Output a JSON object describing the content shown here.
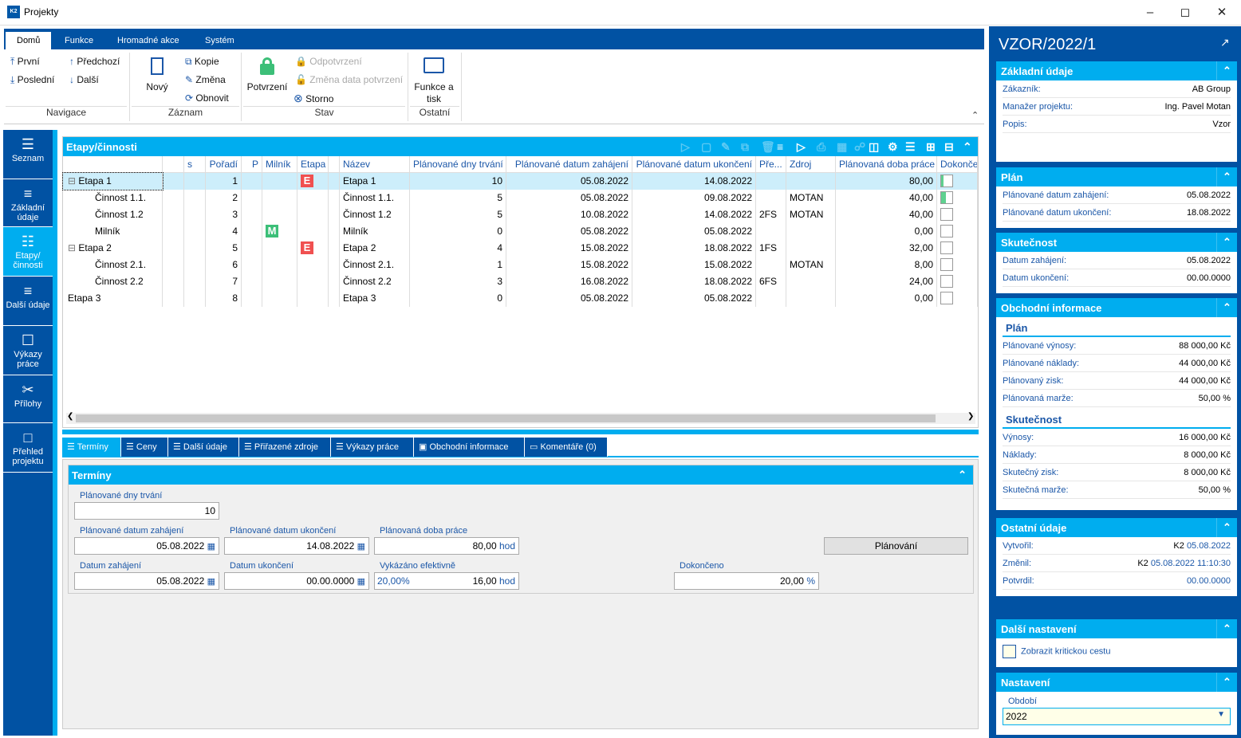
{
  "window": {
    "title": "Projekty",
    "logo": "K2",
    "controls": [
      "minimize-icon",
      "maximize-icon",
      "close-icon"
    ]
  },
  "ribbon": {
    "tabs": [
      "Domů",
      "Funkce",
      "Hromadné akce",
      "Systém"
    ],
    "groups": {
      "navigace": {
        "label": "Navigace",
        "items": [
          "První",
          "Předchozí",
          "Poslední",
          "Další"
        ]
      },
      "zaznam": {
        "label": "Záznam",
        "new": "Nový",
        "items": [
          "Kopie",
          "Změna",
          "Obnovit"
        ]
      },
      "stav": {
        "label": "Stav",
        "confirm": "Potvrzení",
        "items": [
          "Odpotvrzení",
          "Změna data potvrzení",
          "Storno"
        ]
      },
      "ostatni": {
        "label": "Ostatní",
        "print": "Funkce a tisk"
      }
    }
  },
  "leftnav": [
    {
      "label": "Seznam",
      "icon": "menu-icon"
    },
    {
      "label": "Základní údaje",
      "icon": "list-icon"
    },
    {
      "label": "Etapy/ činnosti",
      "icon": "hierarchy-icon",
      "active": true
    },
    {
      "label": "Další údaje",
      "icon": "list-icon"
    },
    {
      "label": "Výkazy práce",
      "icon": "box-icon"
    },
    {
      "label": "Přílohy",
      "icon": "paperclip-icon"
    },
    {
      "label": "Přehled projektu",
      "icon": "overview-icon"
    }
  ],
  "grid": {
    "title": "Etapy/činnosti",
    "columns": [
      "",
      "",
      "s",
      "Pořadí",
      "P",
      "Milník",
      "Etapa",
      "",
      "Název",
      "Plánované dny trvání",
      "Plánované datum zahájení",
      "Plánované datum ukončení",
      "Pře...",
      "Zdroj",
      "Plánovaná doba práce",
      "Dokonče"
    ],
    "rows": [
      {
        "tree": "Etapa 1",
        "level": 0,
        "expand": true,
        "order": "1",
        "milnik": "",
        "etapa": "E",
        "name": "Etapa 1",
        "days": "10",
        "start": "05.08.2022",
        "end": "14.08.2022",
        "pred": "",
        "source": "",
        "work": "80,00",
        "done": 20,
        "selected": true
      },
      {
        "tree": "Činnost 1.1.",
        "level": 1,
        "order": "2",
        "milnik": "",
        "etapa": "",
        "name": "Činnost 1.1.",
        "days": "5",
        "start": "05.08.2022",
        "end": "09.08.2022",
        "pred": "",
        "source": "MOTAN",
        "work": "40,00",
        "done": 40
      },
      {
        "tree": "Činnost 1.2",
        "level": 1,
        "order": "3",
        "milnik": "",
        "etapa": "",
        "name": "Činnost 1.2",
        "days": "5",
        "start": "10.08.2022",
        "end": "14.08.2022",
        "pred": "2FS",
        "source": "MOTAN",
        "work": "40,00",
        "done": 0
      },
      {
        "tree": "Milník",
        "level": 1,
        "order": "4",
        "milnik": "M",
        "etapa": "",
        "name": "Milník",
        "days": "0",
        "start": "05.08.2022",
        "end": "05.08.2022",
        "pred": "",
        "source": "",
        "work": "0,00",
        "done": 0
      },
      {
        "tree": "Etapa 2",
        "level": 0,
        "expand": true,
        "order": "5",
        "milnik": "",
        "etapa": "E",
        "name": "Etapa 2",
        "days": "4",
        "start": "15.08.2022",
        "end": "18.08.2022",
        "pred": "1FS",
        "source": "",
        "work": "32,00",
        "done": 0
      },
      {
        "tree": "Činnost 2.1.",
        "level": 1,
        "order": "6",
        "milnik": "",
        "etapa": "",
        "name": "Činnost 2.1.",
        "days": "1",
        "start": "15.08.2022",
        "end": "15.08.2022",
        "pred": "",
        "source": "MOTAN",
        "work": "8,00",
        "done": 0
      },
      {
        "tree": "Činnost 2.2",
        "level": 1,
        "order": "7",
        "milnik": "",
        "etapa": "",
        "name": "Činnost 2.2",
        "days": "3",
        "start": "16.08.2022",
        "end": "18.08.2022",
        "pred": "6FS",
        "source": "",
        "work": "24,00",
        "done": 0
      },
      {
        "tree": "Etapa 3",
        "level": 0,
        "order": "8",
        "milnik": "",
        "etapa": "",
        "name": "Etapa 3",
        "days": "0",
        "start": "05.08.2022",
        "end": "05.08.2022",
        "pred": "",
        "source": "",
        "work": "0,00",
        "done": 0
      }
    ],
    "colors": {
      "etapa": "#f05050",
      "milnik": "#3cbf78",
      "progress": "#5fd18f"
    }
  },
  "bottom_tabs": [
    "Termíny",
    "Ceny",
    "Další údaje",
    "Přiřazené zdroje",
    "Výkazy práce",
    "Obchodní informace",
    "Komentáře (0)"
  ],
  "form": {
    "title": "Termíny",
    "plan_days_label": "Plánované dny trvání",
    "plan_days": "10",
    "plan_start_label": "Plánované datum zahájení",
    "plan_start": "05.08.2022",
    "plan_end_label": "Plánované datum ukončení",
    "plan_end": "14.08.2022",
    "plan_work_label": "Plánovaná doba práce",
    "plan_work": "80,00",
    "unit_hod": "hod",
    "start_label": "Datum zahájení",
    "start": "05.08.2022",
    "end_label": "Datum ukončení",
    "end": "00.00.0000",
    "reported_label": "Vykázáno efektivně",
    "reported_pct": "20,00%",
    "reported": "16,00",
    "done_label": "Dokončeno",
    "done": "20,00",
    "unit_pct": "%",
    "planning_button": "Plánování"
  },
  "right": {
    "title": "VZOR/2022/1",
    "basic": {
      "title": "Základní údaje",
      "rows": [
        [
          "Zákazník:",
          "AB Group"
        ],
        [
          "Manažer projektu:",
          "Ing. Pavel Motan"
        ],
        [
          "Popis:",
          "Vzor"
        ]
      ]
    },
    "plan": {
      "title": "Plán",
      "rows": [
        [
          "Plánované datum zahájení:",
          "05.08.2022"
        ],
        [
          "Plánované datum ukončení:",
          "18.08.2022"
        ]
      ]
    },
    "actual": {
      "title": "Skutečnost",
      "rows": [
        [
          "Datum zahájení:",
          "05.08.2022"
        ],
        [
          "Datum ukončení:",
          "00.00.0000"
        ]
      ]
    },
    "business": {
      "title": "Obchodní informace",
      "plan_sub": "Plán",
      "plan_rows": [
        [
          "Plánované výnosy:",
          "88 000,00 Kč"
        ],
        [
          "Plánované náklady:",
          "44 000,00 Kč"
        ],
        [
          "Plánovaný zisk:",
          "44 000,00 Kč"
        ],
        [
          "Plánovaná marže:",
          "50,00 %"
        ]
      ],
      "actual_sub": "Skutečnost",
      "actual_rows": [
        [
          "Výnosy:",
          "16 000,00 Kč"
        ],
        [
          "Náklady:",
          "8 000,00 Kč"
        ],
        [
          "Skutečný zisk:",
          "8 000,00 Kč"
        ],
        [
          "Skutečná marže:",
          "50,00 %"
        ]
      ]
    },
    "other": {
      "title": "Ostatní údaje",
      "created_label": "Vytvořil:",
      "created_user": "K2",
      "created_date": "05.08.2022",
      "changed_label": "Změnil:",
      "changed_user": "K2",
      "changed_date": "05.08.2022 11:10:30",
      "confirmed_label": "Potvrdil:",
      "confirmed_date": "00.00.0000"
    },
    "more": {
      "title": "Další nastavení",
      "critical_path": "Zobrazit kritickou cestu",
      "critical_checked": false
    },
    "settings": {
      "title": "Nastavení",
      "period_label": "Období",
      "period": "2022"
    }
  },
  "colors": {
    "dark_blue": "#0152a3",
    "light_blue": "#00adef",
    "selected_row": "#cdeefb"
  }
}
